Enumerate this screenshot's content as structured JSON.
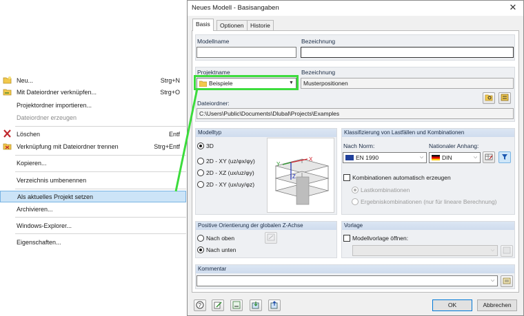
{
  "context_menu": {
    "items": [
      {
        "label": "Neu...",
        "shortcut": "Strg+N",
        "icon": "folder-new-icon"
      },
      {
        "label": "Mit Dateiordner verknüpfen...",
        "shortcut": "Strg+O",
        "icon": "folder-link-icon"
      },
      {
        "label": "Projektordner importieren...",
        "shortcut": ""
      },
      {
        "label": "Dateiordner erzeugen",
        "shortcut": "",
        "disabled": true
      },
      {
        "label": "Löschen",
        "shortcut": "Entf",
        "icon": "delete-x-icon"
      },
      {
        "label": "Verknüpfung mit Dateiordner trennen",
        "shortcut": "Strg+Entf",
        "icon": "unlink-folder-icon"
      },
      {
        "label": "Kopieren...",
        "shortcut": ""
      },
      {
        "label": "Verzeichnis umbenennen",
        "shortcut": ""
      },
      {
        "label": "Als aktuelles Projekt setzen",
        "shortcut": "",
        "selected": true
      },
      {
        "label": "Archivieren...",
        "shortcut": ""
      },
      {
        "label": "Windows-Explorer...",
        "shortcut": ""
      },
      {
        "label": "Eigenschaften...",
        "shortcut": ""
      }
    ]
  },
  "dialog": {
    "title": "Neues Modell - Basisangaben",
    "close": "✕",
    "tabs": [
      "Basis",
      "Optionen",
      "Historie"
    ],
    "model": {
      "name_label": "Modellname",
      "name_value": "",
      "desc_label": "Bezeichnung",
      "desc_value": ""
    },
    "project": {
      "name_label": "Projektname",
      "name_value": "Beispiele",
      "desc_label": "Bezeichnung",
      "desc_value": "Musterpositionen",
      "folder_label": "Dateiordner:",
      "folder_value": "C:\\Users\\Public\\Documents\\Dlubal\\Projects\\Examples"
    },
    "model_type": {
      "header": "Modelltyp",
      "options": [
        "3D",
        "2D - XY (uz/φx/φy)",
        "2D - XZ (ux/uz/φy)",
        "2D - XY (ux/uy/φz)"
      ],
      "selected": 0,
      "axis_x": "X",
      "axis_y": "Y",
      "axis_z": "Z"
    },
    "classification": {
      "header": "Klassifizierung von Lastfällen und Kombinationen",
      "norm_label": "Nach Norm:",
      "norm_value": "EN 1990",
      "annex_label": "Nationaler Anhang:",
      "annex_value": "DIN",
      "auto_combo_label": "Kombinationen automatisch erzeugen",
      "auto_combo_checked": false,
      "opt_load": "Lastkombinationen",
      "opt_result": "Ergebniskombinationen (nur für lineare Berechnung)"
    },
    "z_axis": {
      "header": "Positive Orientierung der globalen Z-Achse",
      "up": "Nach oben",
      "down": "Nach unten",
      "selected": "down"
    },
    "template": {
      "header": "Vorlage",
      "open_label": "Modellvorlage öffnen:",
      "checked": false,
      "value": ""
    },
    "comment": {
      "header": "Kommentar",
      "value": ""
    },
    "buttons": {
      "ok": "OK",
      "cancel": "Abbrechen"
    }
  },
  "colors": {
    "highlight": "#3cdc3c",
    "selection": "#cce4f7",
    "group_header": "#d4e0f0"
  }
}
